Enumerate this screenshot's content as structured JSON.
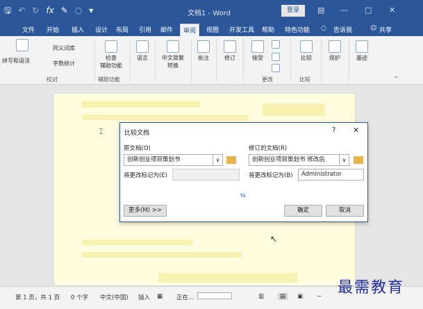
{
  "titlebar": {
    "document_title": "文档1 - Word",
    "login_label": "登录",
    "qat_icons": [
      "save-icon",
      "undo-icon",
      "redo-icon",
      "fx-icon",
      "brush-icon",
      "circle-icon",
      "customize-icon"
    ]
  },
  "ribbon_tabs": [
    "文件",
    "开始",
    "插入",
    "设计",
    "布局",
    "引用",
    "邮件",
    "审阅",
    "视图",
    "开发工具",
    "帮助",
    "特色功能",
    "告诉我",
    "共享"
  ],
  "active_tab": "审阅",
  "ribbon": {
    "proofing": {
      "spelling": "拼写和语法",
      "thesaurus": "同义词库",
      "wordcount": "字数统计",
      "group": "校对"
    },
    "accessibility": {
      "check": "检查",
      "check2": "辅助功能",
      "group": "辅助功能"
    },
    "language": {
      "label": "语言"
    },
    "chinese": {
      "label": "中文简繁",
      "label2": "转换"
    },
    "comments": {
      "label": "批注"
    },
    "tracking": {
      "label": "修订"
    },
    "changes": {
      "accept": "接受",
      "group": "更改"
    },
    "compare": {
      "label": "比较",
      "group": "比较"
    },
    "protect": {
      "label": "保护"
    },
    "ink": {
      "label": "墨迹"
    }
  },
  "dialog": {
    "title": "比较文档",
    "help": "?",
    "close": "✕",
    "original_label": "原文档(O)",
    "original_value": "创新创业项目策划书",
    "original_mark_label": "将更改标记为(E)",
    "original_mark_value": "",
    "revised_label": "修订的文档(R)",
    "revised_value": "创新创业项目策划书 修改后",
    "revised_mark_label": "将更改标记为(B)",
    "revised_mark_value": "Administrator",
    "swap_icon": "⇆",
    "more_button": "更多(M) >>",
    "ok_button": "确定",
    "cancel_button": "取消"
  },
  "statusbar": {
    "page": "第 1 页，共 1 页",
    "words": "0 个字",
    "language": "中文(中国)",
    "insert": "插入",
    "status": "正在..."
  },
  "watermark": "最需教育",
  "colors": {
    "accent": "#2b579a",
    "ribbon_bg": "#f3f3f3",
    "page_bg": "#fffce0"
  }
}
